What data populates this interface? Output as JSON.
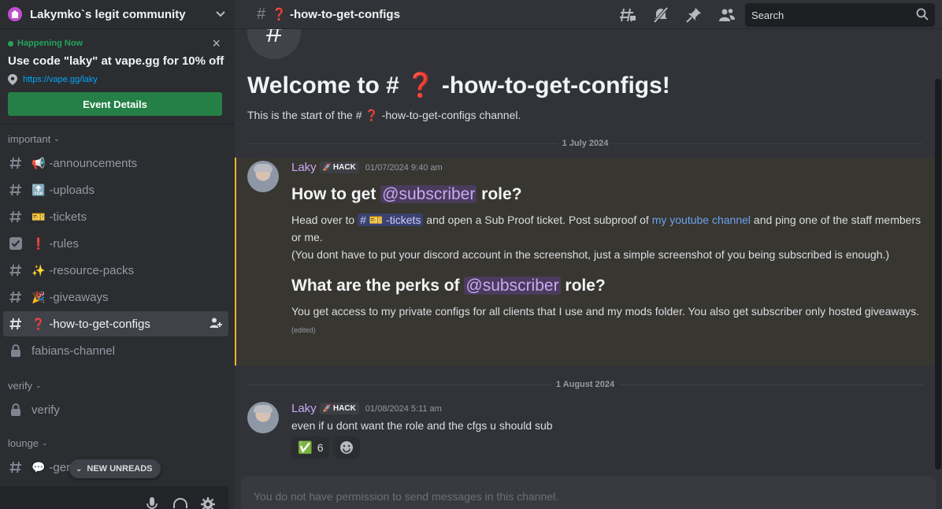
{
  "server": {
    "name": "Lakymko`s legit community"
  },
  "event": {
    "status": "Happening Now",
    "title": "Use code \"laky\" at vape.gg for 10% off",
    "link": "https://vape.gg/laky",
    "button": "Event Details"
  },
  "sidebar": {
    "categories": [
      {
        "label": "important"
      },
      {
        "label": "verify"
      },
      {
        "label": "lounge"
      }
    ],
    "channels": [
      {
        "emoji": "📢",
        "label": "-announcements"
      },
      {
        "emoji": "🔝",
        "label": "-uploads"
      },
      {
        "emoji": "🎫",
        "label": "-tickets"
      },
      {
        "emoji": "❗",
        "label": "-rules"
      },
      {
        "emoji": "✨",
        "label": "-resource-packs"
      },
      {
        "emoji": "🎉",
        "label": "-giveaways"
      },
      {
        "emoji": "❓",
        "label": "-how-to-get-configs"
      },
      {
        "emoji": "",
        "label": "fabians-channel"
      },
      {
        "emoji": "",
        "label": "verify"
      },
      {
        "emoji": "💬",
        "label": "-general"
      }
    ],
    "new_unreads": "NEW UNREADS"
  },
  "header": {
    "channel": "❓ -how-to-get-configs",
    "search_placeholder": "Search"
  },
  "welcome": {
    "title": "Welcome to # ❓ -how-to-get-configs!",
    "subtitle": "This is the start of the # ❓ -how-to-get-configs channel."
  },
  "dividers": [
    "1 July 2024",
    "1 August 2024"
  ],
  "messages": [
    {
      "author": "Laky",
      "tag": "HACK",
      "time": "01/07/2024 9:40 am",
      "heading1_pre": "How to get ",
      "heading1_mention": "@subscriber",
      "heading1_post": " role?",
      "p1_pre": "Head over to ",
      "p1_channel": "# 🎫 -tickets",
      "p1_mid": " and open a Sub Proof ticket. Post subproof of ",
      "p1_link": "my youtube channel",
      "p1_post": " and ping one of the staff members or me.",
      "p2": "(You dont have to put your discord account in the screenshot, just a simple screenshot of you being subscribed is enough.)",
      "heading2_pre": "What are the perks of ",
      "heading2_mention": "@subscriber",
      "heading2_post": " role?",
      "p3": "You get access to my private configs for all clients that I use and my mods folder. You also get subscriber only hosted giveaways.",
      "edited": "(edited)"
    },
    {
      "author": "Laky",
      "tag": "HACK",
      "time": "01/08/2024 5:11 am",
      "text": "even if u dont want the role and the cfgs u should sub",
      "reaction_emoji": "✅",
      "reaction_count": "6"
    }
  ],
  "composer": {
    "placeholder": "You do not have permission to send messages in this channel."
  },
  "colors": {
    "accent": "#248046",
    "role": "#c9a8f5",
    "mention_bg": "#3c4270",
    "highlight_bar": "#f0b232"
  }
}
